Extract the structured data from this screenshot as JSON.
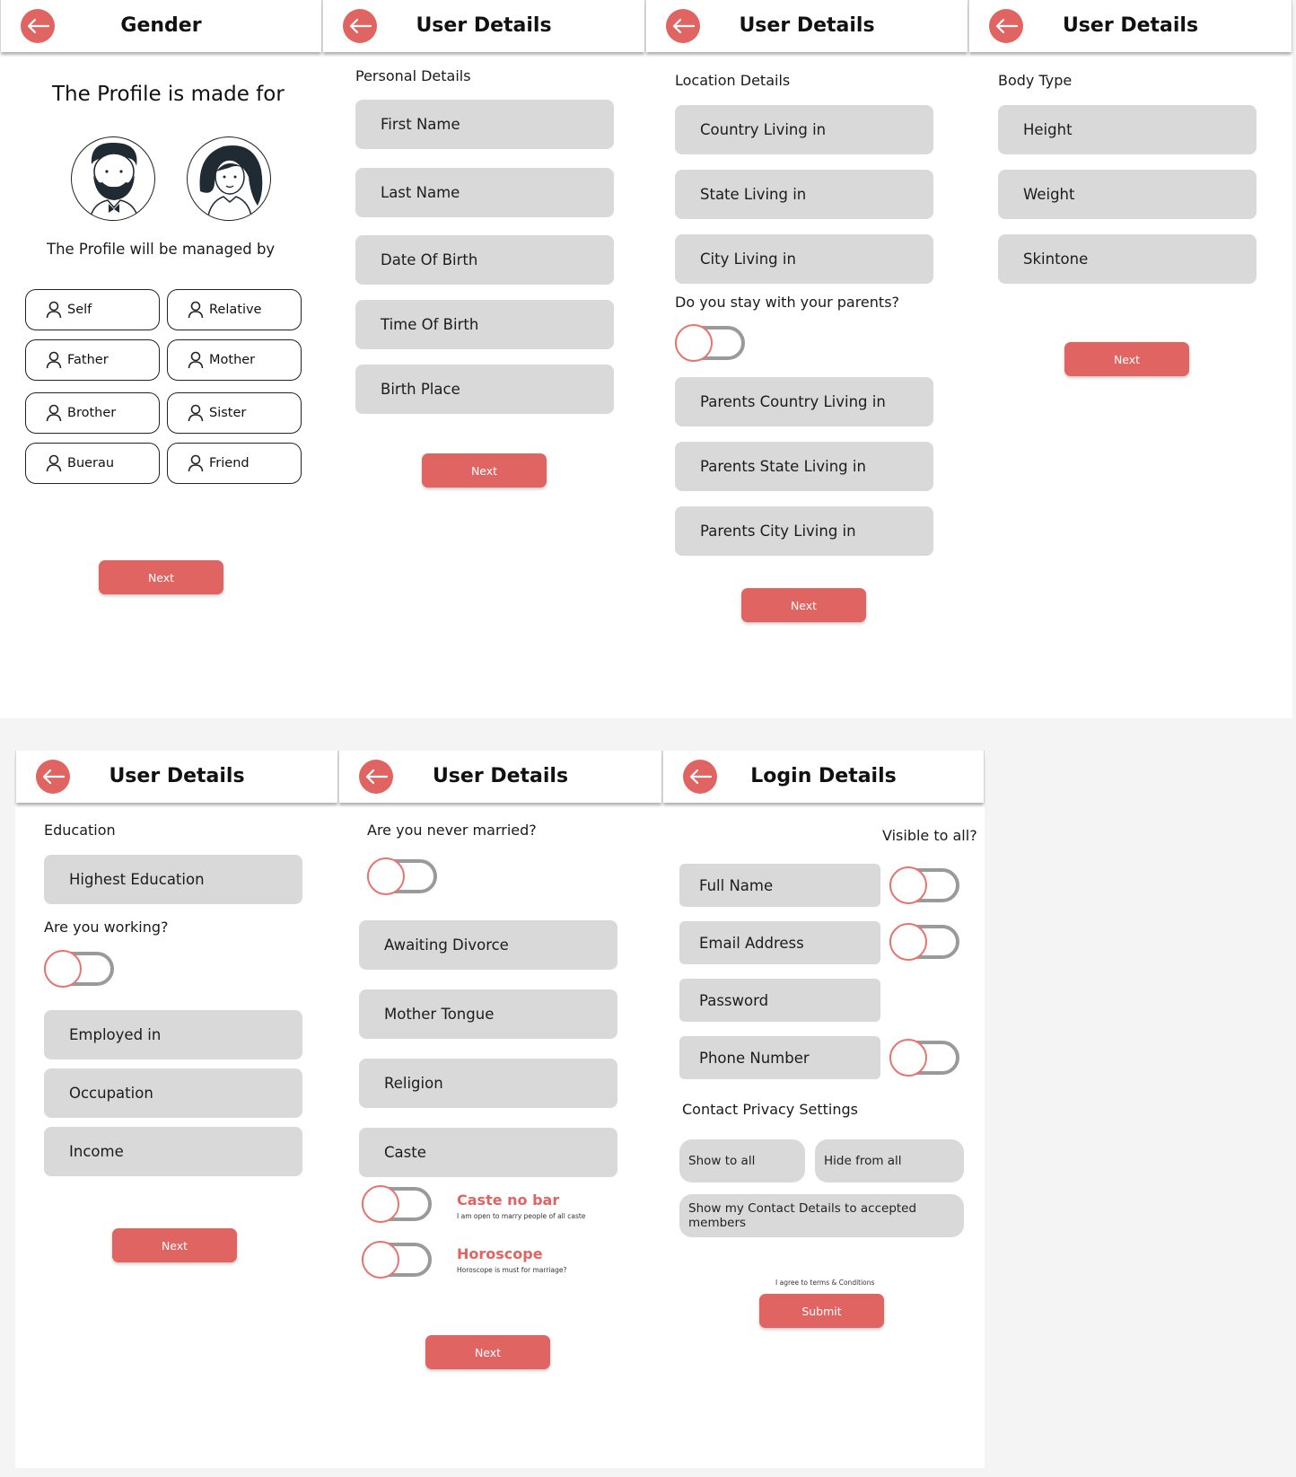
{
  "colors": {
    "accent": "#e06461",
    "field_bg": "#d9d9d9",
    "toggle_track": "#9a9a9a"
  },
  "icons": {
    "back": "arrow-left-icon",
    "person": "user-icon"
  },
  "screen_gender": {
    "title": "Gender",
    "made_for_label": "The Profile is made for",
    "managed_by_label": "The Profile will be managed by",
    "managers": [
      "Self",
      "Relative",
      "Father",
      "Mother",
      "Brother",
      "Sister",
      "Buerau",
      "Friend"
    ],
    "next": "Next"
  },
  "screen_personal": {
    "title": "User Details",
    "section": "Personal Details",
    "fields": [
      "First Name",
      "Last Name",
      "Date Of Birth",
      "Time Of Birth",
      "Birth Place"
    ],
    "next": "Next"
  },
  "screen_location": {
    "title": "User Details",
    "section": "Location Details",
    "fields": [
      "Country Living in",
      "State Living in",
      "City Living in"
    ],
    "question": "Do you stay with your parents?",
    "parent_fields": [
      "Parents Country Living in",
      "Parents State Living in",
      "Parents City Living in"
    ],
    "next": "Next"
  },
  "screen_body": {
    "title": "User Details",
    "section": "Body Type",
    "fields": [
      "Height",
      "Weight",
      "Skintone"
    ],
    "next": "Next"
  },
  "screen_education": {
    "title": "User Details",
    "section": "Education",
    "highest": "Highest Education",
    "question": "Are you working?",
    "fields": [
      "Employed in",
      "Occupation",
      "Income"
    ],
    "next": "Next"
  },
  "screen_marital": {
    "title": "User Details",
    "question": "Are you never married?",
    "fields": [
      "Awaiting Divorce",
      "Mother Tongue",
      "Religion",
      "Caste"
    ],
    "caste_title": "Caste no bar",
    "caste_sub": "I am open to marry people of all caste",
    "horo_title": "Horoscope",
    "horo_sub": "Horoscope is must for marriage?",
    "next": "Next"
  },
  "screen_login": {
    "title": "Login Details",
    "visible_label": "Visible to all?",
    "fields": [
      "Full Name",
      "Email Address",
      "Password",
      "Phone Number"
    ],
    "privacy_label": "Contact Privacy Settings",
    "show_all": "Show to all",
    "hide_all": "Hide from all",
    "show_accepted": "Show my Contact Details to accepted members",
    "terms": "I agree to terms & Conditions",
    "submit": "Submit"
  }
}
